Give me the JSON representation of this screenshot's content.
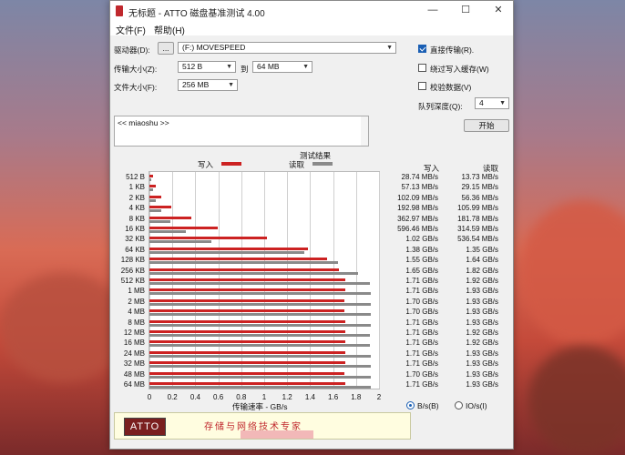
{
  "window": {
    "title": "无标题 - ATTO 磁盘基准测试 4.00",
    "controls": {
      "minimize": "—",
      "maximize": "☐",
      "close": "✕"
    }
  },
  "menu": {
    "file": "文件(F)",
    "help": "帮助(H)"
  },
  "settings": {
    "drive_label": "驱动器(D):",
    "browse_label": "...",
    "drive_value": "(F:) MOVESPEED",
    "transfer_label": "传输大小(Z):",
    "transfer_from": "512 B",
    "to_label": "到",
    "transfer_to": "64 MB",
    "file_size_label": "文件大小(F):",
    "file_size": "256 MB",
    "direct_io_label": "直接传输(R).",
    "bypass_cache_label": "绕过写入缓存(W)",
    "verify_label": "校验数据(V)",
    "queue_depth_label": "队列深度(Q):",
    "queue_depth": "4",
    "start_button": "开始"
  },
  "description": {
    "text": "<< miaoshu >>"
  },
  "results": {
    "header": "测试结果",
    "legend_write": "写入",
    "legend_read": "读取",
    "col_write": "写入",
    "col_read": "读取",
    "rows": [
      {
        "size": "512 B",
        "write": "28.74 MB/s",
        "read": "13.73 MB/s"
      },
      {
        "size": "1 KB",
        "write": "57.13 MB/s",
        "read": "29.15 MB/s"
      },
      {
        "size": "2 KB",
        "write": "102.09 MB/s",
        "read": "56.36 MB/s"
      },
      {
        "size": "4 KB",
        "write": "192.98 MB/s",
        "read": "105.99 MB/s"
      },
      {
        "size": "8 KB",
        "write": "362.97 MB/s",
        "read": "181.78 MB/s"
      },
      {
        "size": "16 KB",
        "write": "596.46 MB/s",
        "read": "314.59 MB/s"
      },
      {
        "size": "32 KB",
        "write": "1.02 GB/s",
        "read": "536.54 MB/s"
      },
      {
        "size": "64 KB",
        "write": "1.38 GB/s",
        "read": "1.35 GB/s"
      },
      {
        "size": "128 KB",
        "write": "1.55 GB/s",
        "read": "1.64 GB/s"
      },
      {
        "size": "256 KB",
        "write": "1.65 GB/s",
        "read": "1.82 GB/s"
      },
      {
        "size": "512 KB",
        "write": "1.71 GB/s",
        "read": "1.92 GB/s"
      },
      {
        "size": "1 MB",
        "write": "1.71 GB/s",
        "read": "1.93 GB/s"
      },
      {
        "size": "2 MB",
        "write": "1.70 GB/s",
        "read": "1.93 GB/s"
      },
      {
        "size": "4 MB",
        "write": "1.70 GB/s",
        "read": "1.93 GB/s"
      },
      {
        "size": "8 MB",
        "write": "1.71 GB/s",
        "read": "1.93 GB/s"
      },
      {
        "size": "12 MB",
        "write": "1.71 GB/s",
        "read": "1.92 GB/s"
      },
      {
        "size": "16 MB",
        "write": "1.71 GB/s",
        "read": "1.92 GB/s"
      },
      {
        "size": "24 MB",
        "write": "1.71 GB/s",
        "read": "1.93 GB/s"
      },
      {
        "size": "32 MB",
        "write": "1.71 GB/s",
        "read": "1.93 GB/s"
      },
      {
        "size": "48 MB",
        "write": "1.70 GB/s",
        "read": "1.93 GB/s"
      },
      {
        "size": "64 MB",
        "write": "1.71 GB/s",
        "read": "1.93 GB/s"
      }
    ],
    "x_axis_label": "传输速率 - GB/s",
    "x_ticks": [
      "0",
      "0.2",
      "0.4",
      "0.6",
      "0.8",
      "1",
      "1.2",
      "1.4",
      "1.6",
      "1.8",
      "2"
    ],
    "unit_bytes": "B/s(B)",
    "unit_io": "IO/s(I)"
  },
  "chart_data": {
    "type": "bar",
    "orientation": "horizontal",
    "categories": [
      "512 B",
      "1 KB",
      "2 KB",
      "4 KB",
      "8 KB",
      "16 KB",
      "32 KB",
      "64 KB",
      "128 KB",
      "256 KB",
      "512 KB",
      "1 MB",
      "2 MB",
      "4 MB",
      "8 MB",
      "12 MB",
      "16 MB",
      "24 MB",
      "32 MB",
      "48 MB",
      "64 MB"
    ],
    "series": [
      {
        "name": "写入",
        "color": "#cc2222",
        "values": [
          0.02874,
          0.05713,
          0.10209,
          0.19298,
          0.36297,
          0.59646,
          1.02,
          1.38,
          1.55,
          1.65,
          1.71,
          1.71,
          1.7,
          1.7,
          1.71,
          1.71,
          1.71,
          1.71,
          1.71,
          1.7,
          1.71
        ]
      },
      {
        "name": "读取",
        "color": "#8a8a8a",
        "values": [
          0.01373,
          0.02915,
          0.05636,
          0.10599,
          0.18178,
          0.31459,
          0.53654,
          1.35,
          1.64,
          1.82,
          1.92,
          1.93,
          1.93,
          1.93,
          1.93,
          1.92,
          1.92,
          1.93,
          1.93,
          1.93,
          1.93
        ]
      }
    ],
    "xlabel": "传输速率 - GB/s",
    "xlim": [
      0,
      2
    ],
    "grid": true
  },
  "banner": {
    "logo": "ATTO",
    "text": "存储与网络技术专家"
  }
}
